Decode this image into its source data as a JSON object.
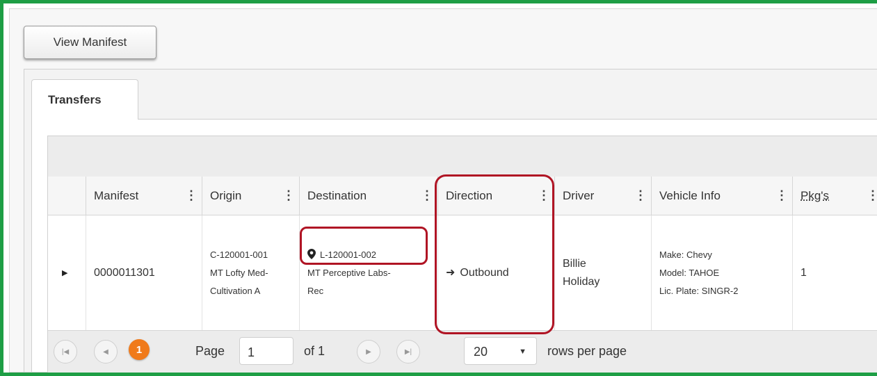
{
  "toolbar": {
    "view_manifest_label": "View Manifest"
  },
  "tabs": [
    {
      "label": "Transfers"
    }
  ],
  "columns": [
    {
      "label": "Manifest"
    },
    {
      "label": "Origin"
    },
    {
      "label": "Destination"
    },
    {
      "label": "Direction"
    },
    {
      "label": "Driver"
    },
    {
      "label": "Vehicle Info"
    },
    {
      "label": "Pkg's"
    }
  ],
  "row": {
    "manifest": "0000011301",
    "origin": {
      "line1": "C-120001-001",
      "line2": "MT Lofty Med-",
      "line3": "Cultivation A"
    },
    "destination": {
      "license": "L-120001-002",
      "line2": "MT Perceptive Labs-",
      "line3": "Rec"
    },
    "direction": "Outbound",
    "driver": {
      "line1": "Billie",
      "line2": "Holiday"
    },
    "vehicle": {
      "make": "Make: Chevy",
      "model": "Model: TAHOE",
      "plate": "Lic. Plate: SINGR-2"
    },
    "pkgs": "1"
  },
  "pager": {
    "current_page_badge": "1",
    "page_label": "Page",
    "page_input_value": "1",
    "of_label": "of 1",
    "rows_per_page_value": "20",
    "rows_per_page_label": "rows per page"
  },
  "colors": {
    "frame": "#1e9e45",
    "highlight": "#b01424",
    "page_badge": "#f07a1a"
  }
}
